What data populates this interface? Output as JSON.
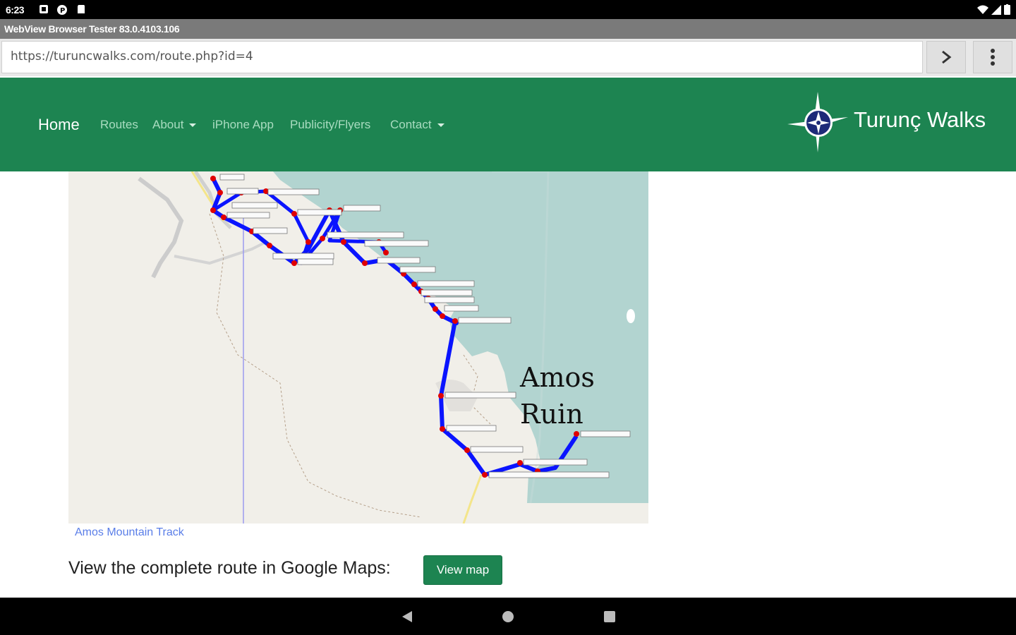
{
  "status_bar": {
    "time": "6:23"
  },
  "app_bar": {
    "title": "WebView Browser Tester 83.0.4103.106"
  },
  "url_bar": {
    "url": "https://turuncwalks.com/route.php?id=4"
  },
  "nav": {
    "home": "Home",
    "items": [
      "Routes",
      "About",
      "iPhone App",
      "Publicity/Flyers",
      "Contact"
    ],
    "brand": "Turunç Walks"
  },
  "map": {
    "place_label_line1": "Amos",
    "place_label_line2": "Ruin",
    "caption": "Amos Mountain Track"
  },
  "google_maps": {
    "text": "View the complete route in Google Maps:",
    "button": "View map"
  },
  "colors": {
    "navbar": "#1d8451",
    "route": "#0a14ff",
    "sea": "#b2d4d0",
    "land": "#f1efe9"
  }
}
